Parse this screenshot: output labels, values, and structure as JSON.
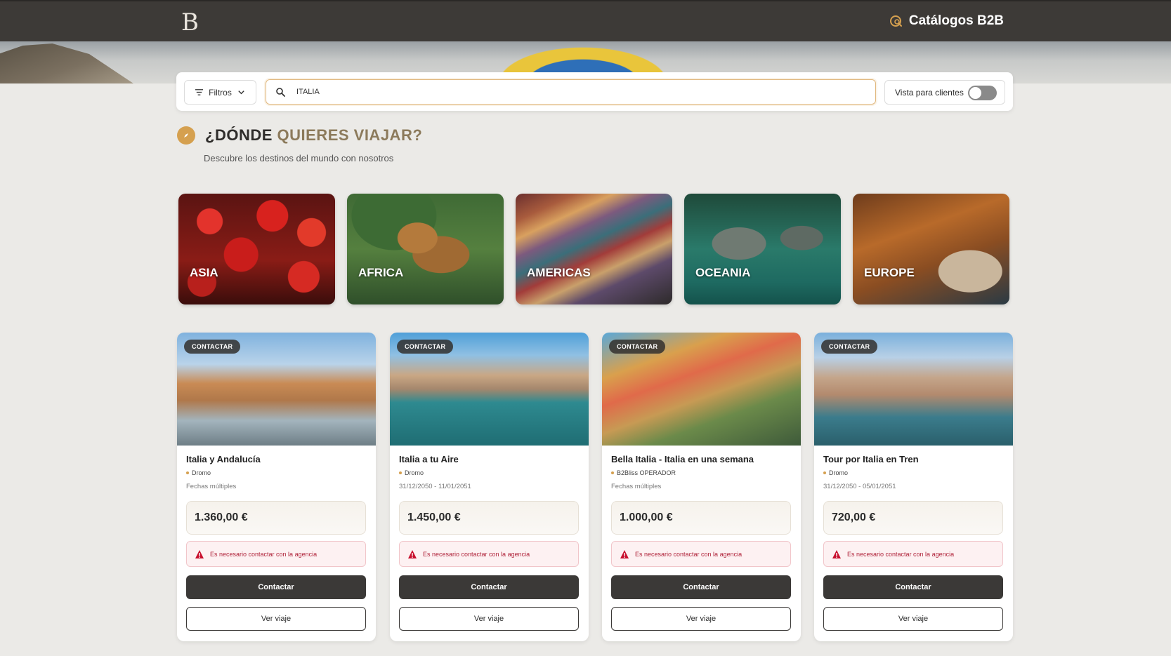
{
  "header": {
    "logo": "B",
    "catalogs_label": "Catálogos B2B",
    "catalogs_icon": "catalog-search-icon"
  },
  "search": {
    "filters_label": "Filtros",
    "query": "ITALIA",
    "client_view_label": "Vista para clientes",
    "client_view_on": false
  },
  "section": {
    "title_part1": "¿DÓNDE",
    "title_part2": "QUIERES VIAJAR?",
    "subtitle": "Descubre los destinos del mundo con nosotros",
    "icon": "compass-icon"
  },
  "continents": [
    {
      "label": "ASIA"
    },
    {
      "label": "AFRICA"
    },
    {
      "label": "AMERICAS"
    },
    {
      "label": "OCEANIA"
    },
    {
      "label": "EUROPE"
    }
  ],
  "trips": [
    {
      "badge": "CONTACTAR",
      "title": "Italia y Andalucía",
      "operator": "Dromo",
      "dates": "Fechas múltiples",
      "price": "1.360,00 €",
      "warning": "Es necesario contactar con la agencia",
      "contact_label": "Contactar",
      "view_label": "Ver viaje"
    },
    {
      "badge": "CONTACTAR",
      "title": "Italia a tu Aire",
      "operator": "Dromo",
      "dates": "31/12/2050 - 11/01/2051",
      "price": "1.450,00 €",
      "warning": "Es necesario contactar con la agencia",
      "contact_label": "Contactar",
      "view_label": "Ver viaje"
    },
    {
      "badge": "CONTACTAR",
      "title": "Bella Italia - Italia en una semana",
      "operator": "B2Bliss OPERADOR",
      "dates": "Fechas múltiples",
      "price": "1.000,00 €",
      "warning": "Es necesario contactar con la agencia",
      "contact_label": "Contactar",
      "view_label": "Ver viaje"
    },
    {
      "badge": "CONTACTAR",
      "title": "Tour por Italia en Tren",
      "operator": "Dromo",
      "dates": "31/12/2050 - 05/01/2051",
      "price": "720,00 €",
      "warning": "Es necesario contactar con la agencia",
      "contact_label": "Contactar",
      "view_label": "Ver viaje"
    }
  ],
  "colors": {
    "topbar": "#3d3a37",
    "accent": "#d5a04f",
    "title_accent": "#8c7a5b",
    "warning": "#b0233a",
    "button_dark": "#3b3937"
  }
}
